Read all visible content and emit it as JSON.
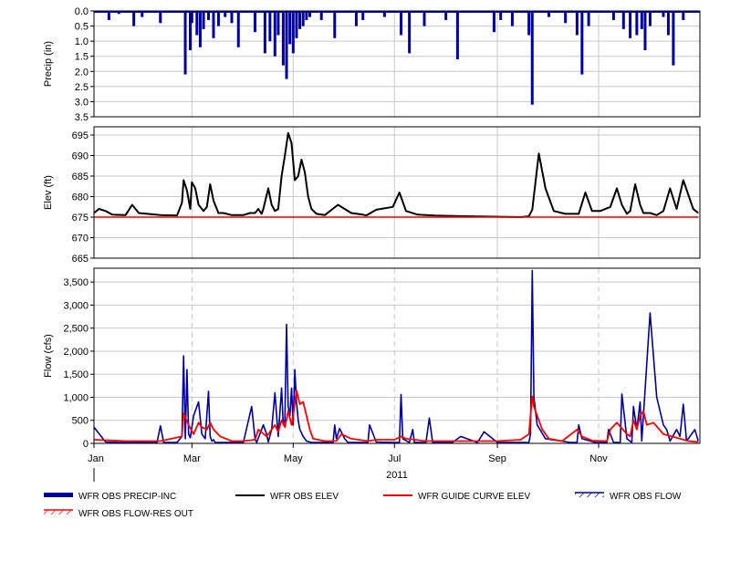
{
  "chart_data": {
    "type": "multi-panel-timeseries",
    "year_label": "2011",
    "x_ticks": [
      "Jan",
      "Mar",
      "May",
      "Jul",
      "Sep",
      "Nov"
    ],
    "x_range": [
      "2011-01-01",
      "2011-12-31"
    ],
    "panels": [
      {
        "id": "precip",
        "type": "bar",
        "ylabel": "Precip (in)",
        "ylim": [
          0,
          3.5
        ],
        "inverted": true,
        "yticks": [
          "0.0",
          "0.5",
          "1.0",
          "1.5",
          "2.0",
          "2.5",
          "3.0",
          "3.5"
        ],
        "grid": true,
        "series": [
          {
            "name": "WFR OBS PRECIP-INC",
            "color": "#0000a0",
            "x": [
              "2011-01-10",
              "2011-01-16",
              "2011-01-25",
              "2011-01-30",
              "2011-02-10",
              "2011-02-25",
              "2011-02-28",
              "2011-03-01",
              "2011-03-04",
              "2011-03-06",
              "2011-03-08",
              "2011-03-11",
              "2011-03-14",
              "2011-03-17",
              "2011-03-21",
              "2011-03-25",
              "2011-03-29",
              "2011-04-08",
              "2011-04-14",
              "2011-04-17",
              "2011-04-20",
              "2011-04-22",
              "2011-04-25",
              "2011-04-27",
              "2011-04-29",
              "2011-05-01",
              "2011-05-03",
              "2011-05-05",
              "2011-05-07",
              "2011-05-09",
              "2011-05-11",
              "2011-05-18",
              "2011-05-26",
              "2011-06-08",
              "2011-06-12",
              "2011-06-25",
              "2011-07-05",
              "2011-07-10",
              "2011-07-19",
              "2011-08-01",
              "2011-08-08",
              "2011-08-30",
              "2011-09-03",
              "2011-09-10",
              "2011-09-20",
              "2011-09-22",
              "2011-10-02",
              "2011-10-12",
              "2011-10-19",
              "2011-10-22",
              "2011-10-26",
              "2011-11-10",
              "2011-11-16",
              "2011-11-20",
              "2011-11-24",
              "2011-11-27",
              "2011-11-29",
              "2011-12-02",
              "2011-12-10",
              "2011-12-13",
              "2011-12-16",
              "2011-12-22"
            ],
            "values": [
              0.3,
              0.1,
              0.5,
              0.2,
              0.4,
              2.1,
              1.3,
              0.4,
              0.8,
              1.2,
              0.6,
              0.3,
              0.9,
              0.5,
              0.2,
              0.4,
              1.2,
              0.7,
              1.4,
              1.0,
              1.5,
              0.8,
              1.8,
              2.25,
              1.1,
              1.4,
              0.9,
              0.6,
              0.5,
              0.3,
              0.2,
              0.3,
              0.9,
              0.5,
              0.3,
              0.2,
              0.8,
              1.4,
              0.5,
              0.3,
              1.6,
              0.7,
              0.3,
              0.5,
              0.8,
              3.1,
              0.2,
              0.4,
              0.8,
              2.1,
              0.5,
              0.3,
              0.6,
              0.9,
              0.8,
              0.6,
              1.3,
              0.5,
              0.2,
              0.8,
              1.8,
              0.3
            ]
          }
        ]
      },
      {
        "id": "elev",
        "type": "line",
        "ylabel": "Elev (ft)",
        "ylim": [
          665,
          697
        ],
        "yticks": [
          "665",
          "670",
          "675",
          "680",
          "685",
          "690",
          "695"
        ],
        "grid": true,
        "series": [
          {
            "name": "WFR OBS ELEV",
            "color": "#000000",
            "x": [
              "2011-01-01",
              "2011-01-04",
              "2011-01-08",
              "2011-01-12",
              "2011-01-20",
              "2011-01-24",
              "2011-01-28",
              "2011-02-10",
              "2011-02-20",
              "2011-02-23",
              "2011-02-24",
              "2011-02-26",
              "2011-02-28",
              "2011-03-01",
              "2011-03-03",
              "2011-03-05",
              "2011-03-08",
              "2011-03-10",
              "2011-03-12",
              "2011-03-14",
              "2011-03-17",
              "2011-03-20",
              "2011-03-25",
              "2011-04-01",
              "2011-04-05",
              "2011-04-08",
              "2011-04-10",
              "2011-04-12",
              "2011-04-13",
              "2011-04-16",
              "2011-04-18",
              "2011-04-20",
              "2011-04-22",
              "2011-04-24",
              "2011-04-26",
              "2011-04-28",
              "2011-04-30",
              "2011-05-02",
              "2011-05-04",
              "2011-05-06",
              "2011-05-08",
              "2011-05-10",
              "2011-05-12",
              "2011-05-15",
              "2011-05-20",
              "2011-05-28",
              "2011-06-05",
              "2011-06-12",
              "2011-06-14",
              "2011-06-20",
              "2011-06-30",
              "2011-07-04",
              "2011-07-08",
              "2011-07-15",
              "2011-07-25",
              "2011-08-15",
              "2011-09-15",
              "2011-09-20",
              "2011-09-22",
              "2011-09-26",
              "2011-09-30",
              "2011-10-05",
              "2011-10-12",
              "2011-10-20",
              "2011-10-24",
              "2011-10-28",
              "2011-11-02",
              "2011-11-08",
              "2011-11-12",
              "2011-11-15",
              "2011-11-18",
              "2011-11-20",
              "2011-11-23",
              "2011-11-26",
              "2011-11-28",
              "2011-12-02",
              "2011-12-06",
              "2011-12-10",
              "2011-12-14",
              "2011-12-18",
              "2011-12-22",
              "2011-12-28",
              "2011-12-31"
            ],
            "values": [
              676,
              677,
              676.5,
              675.6,
              675.5,
              678,
              676,
              675.5,
              675.4,
              678.5,
              684,
              681.5,
              677,
              683.5,
              682,
              678,
              676.5,
              677.5,
              683,
              679,
              676,
              676,
              675.5,
              675.5,
              676,
              676,
              677,
              675.8,
              677,
              682,
              678,
              676.5,
              677,
              685,
              690,
              695.5,
              693,
              684,
              685,
              689,
              686,
              680,
              677,
              675.8,
              675.5,
              678,
              676,
              675.6,
              675.4,
              676.8,
              677.5,
              681,
              676.5,
              675.6,
              675.4,
              675.2,
              675,
              675.2,
              676.8,
              690.5,
              682,
              676.5,
              675.8,
              675.8,
              681,
              676.5,
              676.5,
              677.5,
              682,
              678,
              675.8,
              676.5,
              683,
              678,
              676,
              676,
              675.5,
              676.5,
              682,
              677,
              684,
              677,
              676
            ]
          },
          {
            "name": "WFR GUIDE CURVE ELEV",
            "color": "#ff0000",
            "x": [
              "2011-01-01",
              "2011-12-31"
            ],
            "values": [
              675,
              675
            ]
          }
        ]
      },
      {
        "id": "flow",
        "type": "line",
        "ylabel": "Flow (cfs)",
        "ylim": [
          0,
          3800
        ],
        "yticks": [
          "0",
          "500",
          "1,000",
          "1,500",
          "2,000",
          "2,500",
          "3,000",
          "3,500"
        ],
        "grid": true,
        "series": [
          {
            "name": "WFR OBS FLOW",
            "color": "#0000a0",
            "x": [
              "2011-01-01",
              "2011-01-08",
              "2011-01-15",
              "2011-01-25",
              "2011-02-08",
              "2011-02-10",
              "2011-02-12",
              "2011-02-20",
              "2011-02-23",
              "2011-02-24",
              "2011-02-25",
              "2011-02-26",
              "2011-02-27",
              "2011-02-28",
              "2011-03-02",
              "2011-03-05",
              "2011-03-07",
              "2011-03-09",
              "2011-03-11",
              "2011-03-12",
              "2011-03-13",
              "2011-03-14",
              "2011-03-15",
              "2011-03-16",
              "2011-03-20",
              "2011-04-01",
              "2011-04-06",
              "2011-04-08",
              "2011-04-09",
              "2011-04-13",
              "2011-04-15",
              "2011-04-16",
              "2011-04-18",
              "2011-04-20",
              "2011-04-22",
              "2011-04-24",
              "2011-04-25",
              "2011-04-26",
              "2011-04-27",
              "2011-04-28",
              "2011-04-29",
              "2011-04-30",
              "2011-05-01",
              "2011-05-02",
              "2011-05-03",
              "2011-05-04",
              "2011-05-05",
              "2011-05-07",
              "2011-05-09",
              "2011-05-12",
              "2011-05-20",
              "2011-05-25",
              "2011-05-26",
              "2011-05-27",
              "2011-05-29",
              "2011-06-01",
              "2011-06-03",
              "2011-06-15",
              "2011-06-16",
              "2011-06-20",
              "2011-06-30",
              "2011-07-04",
              "2011-07-05",
              "2011-07-06",
              "2011-07-10",
              "2011-07-12",
              "2011-07-13",
              "2011-07-16",
              "2011-07-20",
              "2011-07-22",
              "2011-07-24",
              "2011-07-28",
              "2011-08-05",
              "2011-08-10",
              "2011-08-20",
              "2011-08-24",
              "2011-09-01",
              "2011-09-15",
              "2011-09-20",
              "2011-09-21",
              "2011-09-22",
              "2011-09-23",
              "2011-09-25",
              "2011-09-30",
              "2011-10-15",
              "2011-10-19",
              "2011-10-20",
              "2011-10-22",
              "2011-10-30",
              "2011-11-01",
              "2011-11-06",
              "2011-11-07",
              "2011-11-10",
              "2011-11-14",
              "2011-11-15",
              "2011-11-18",
              "2011-11-21",
              "2011-11-22",
              "2011-11-24",
              "2011-11-26",
              "2011-11-27",
              "2011-11-28",
              "2011-12-02",
              "2011-12-06",
              "2011-12-10",
              "2011-12-12",
              "2011-12-14",
              "2011-12-18",
              "2011-12-20",
              "2011-12-22",
              "2011-12-24",
              "2011-12-27",
              "2011-12-29",
              "2011-12-31"
            ],
            "values": [
              350,
              30,
              20,
              20,
              20,
              380,
              20,
              20,
              150,
              1900,
              100,
              1600,
              200,
              120,
              600,
              900,
              200,
              100,
              1130,
              150,
              50,
              80,
              20,
              20,
              20,
              20,
              800,
              100,
              20,
              400,
              200,
              30,
              300,
              1100,
              150,
              1200,
              400,
              500,
              2580,
              800,
              600,
              1200,
              400,
              1600,
              900,
              500,
              300,
              150,
              50,
              20,
              20,
              20,
              400,
              100,
              320,
              100,
              20,
              20,
              400,
              30,
              20,
              20,
              1060,
              100,
              20,
              300,
              20,
              20,
              20,
              550,
              20,
              20,
              20,
              150,
              20,
              250,
              20,
              20,
              20,
              200,
              3750,
              1000,
              400,
              100,
              20,
              20,
              400,
              100,
              20,
              20,
              20,
              300,
              20,
              20,
              1070,
              100,
              20,
              800,
              300,
              900,
              50,
              600,
              2830,
              1000,
              400,
              300,
              50,
              300,
              150,
              850,
              50,
              200,
              300,
              50
            ]
          },
          {
            "name": "WFR OBS FLOW-RES OUT",
            "color": "#ff0000",
            "x": [
              "2011-01-01",
              "2011-01-20",
              "2011-02-10",
              "2011-02-23",
              "2011-02-24",
              "2011-02-27",
              "2011-03-02",
              "2011-03-05",
              "2011-03-07",
              "2011-03-10",
              "2011-03-12",
              "2011-03-14",
              "2011-03-18",
              "2011-03-25",
              "2011-04-01",
              "2011-04-08",
              "2011-04-10",
              "2011-04-15",
              "2011-04-18",
              "2011-04-20",
              "2011-04-22",
              "2011-04-24",
              "2011-04-26",
              "2011-04-28",
              "2011-04-30",
              "2011-05-01",
              "2011-05-03",
              "2011-05-05",
              "2011-05-07",
              "2011-05-09",
              "2011-05-11",
              "2011-05-13",
              "2011-05-20",
              "2011-05-27",
              "2011-05-30",
              "2011-06-05",
              "2011-06-15",
              "2011-06-20",
              "2011-07-01",
              "2011-07-05",
              "2011-07-08",
              "2011-07-20",
              "2011-08-01",
              "2011-08-20",
              "2011-09-01",
              "2011-09-15",
              "2011-09-20",
              "2011-09-22",
              "2011-09-23",
              "2011-09-25",
              "2011-09-28",
              "2011-10-02",
              "2011-10-10",
              "2011-10-19",
              "2011-10-22",
              "2011-10-28",
              "2011-11-06",
              "2011-11-08",
              "2011-11-12",
              "2011-11-18",
              "2011-11-20",
              "2011-11-22",
              "2011-11-24",
              "2011-11-26",
              "2011-11-28",
              "2011-11-30",
              "2011-12-04",
              "2011-12-10",
              "2011-12-15",
              "2011-12-20",
              "2011-12-25",
              "2011-12-31"
            ],
            "values": [
              80,
              50,
              50,
              150,
              650,
              400,
              200,
              450,
              350,
              300,
              450,
              300,
              150,
              50,
              50,
              80,
              300,
              150,
              300,
              400,
              250,
              500,
              350,
              700,
              400,
              600,
              1150,
              850,
              900,
              600,
              300,
              100,
              50,
              50,
              200,
              100,
              50,
              80,
              80,
              150,
              100,
              50,
              50,
              50,
              50,
              80,
              200,
              1020,
              800,
              600,
              300,
              100,
              50,
              300,
              150,
              60,
              50,
              300,
              450,
              200,
              150,
              500,
              300,
              600,
              700,
              400,
              450,
              200,
              150,
              100,
              50,
              30
            ]
          }
        ]
      }
    ],
    "legend": {
      "placement": "bottom",
      "entries": [
        {
          "label": "WFR OBS PRECIP-INC",
          "style": "thick",
          "color": "#0000a0"
        },
        {
          "label": "WFR OBS ELEV",
          "style": "line",
          "color": "#000000"
        },
        {
          "label": "WFR GUIDE CURVE ELEV",
          "style": "line",
          "color": "#ff0000"
        },
        {
          "label": "WFR OBS FLOW",
          "style": "hatch",
          "color": "#0000a0"
        },
        {
          "label": "WFR OBS FLOW-RES OUT",
          "style": "hatch",
          "color": "#ff0000"
        }
      ]
    }
  }
}
